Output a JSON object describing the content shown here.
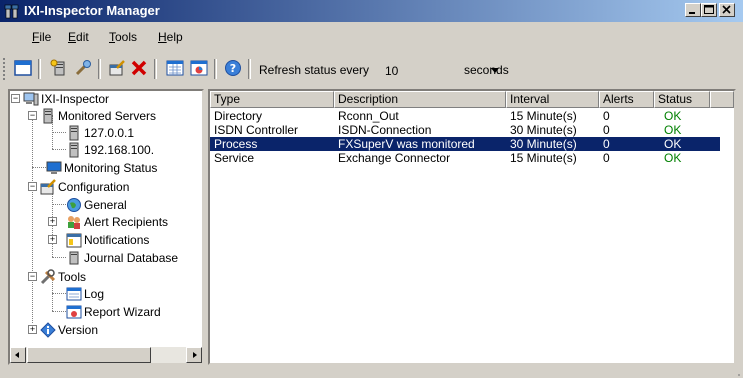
{
  "app": {
    "title": "IXI-Inspector Manager"
  },
  "menu": {
    "items": [
      {
        "pre": "",
        "u": "F",
        "post": "ile"
      },
      {
        "pre": "",
        "u": "E",
        "post": "dit"
      },
      {
        "pre": "",
        "u": "T",
        "post": "ools"
      },
      {
        "pre": "",
        "u": "H",
        "post": "elp"
      }
    ]
  },
  "toolbar": {
    "refresh_label": "Refresh status every",
    "refresh_value": "10",
    "refresh_unit": "seconds"
  },
  "tree": {
    "root": "IXI-Inspector",
    "monitored_servers": "Monitored Servers",
    "server1": "127.0.0.1",
    "server2": "192.168.100.",
    "monitoring_status": "Monitoring Status",
    "configuration": "Configuration",
    "general": "General",
    "alert_recipients": "Alert Recipients",
    "notifications": "Notifications",
    "journal_database": "Journal Database",
    "tools": "Tools",
    "log": "Log",
    "report_wizard": "Report Wizard",
    "version": "Version"
  },
  "list": {
    "columns": [
      "Type",
      "Description",
      "Interval",
      "Alerts",
      "Status"
    ],
    "rows": [
      {
        "type": "Directory",
        "description": "Rconn_Out",
        "interval": "15 Minute(s)",
        "alerts": "0",
        "status": "OK",
        "selected": false
      },
      {
        "type": "ISDN Controller",
        "description": "ISDN-Connection",
        "interval": "30 Minute(s)",
        "alerts": "0",
        "status": "OK",
        "selected": false
      },
      {
        "type": "Process",
        "description": "FXSuperV was monitored",
        "interval": "30 Minute(s)",
        "alerts": "0",
        "status": "OK",
        "selected": true
      },
      {
        "type": "Service",
        "description": "Exchange Connector",
        "interval": "15 Minute(s)",
        "alerts": "0",
        "status": "OK",
        "selected": false
      }
    ]
  },
  "colors": {
    "title_bar": "#0a246a",
    "selection": "#0a246a",
    "ok_status": "#008000",
    "face": "#d4d0c8"
  }
}
